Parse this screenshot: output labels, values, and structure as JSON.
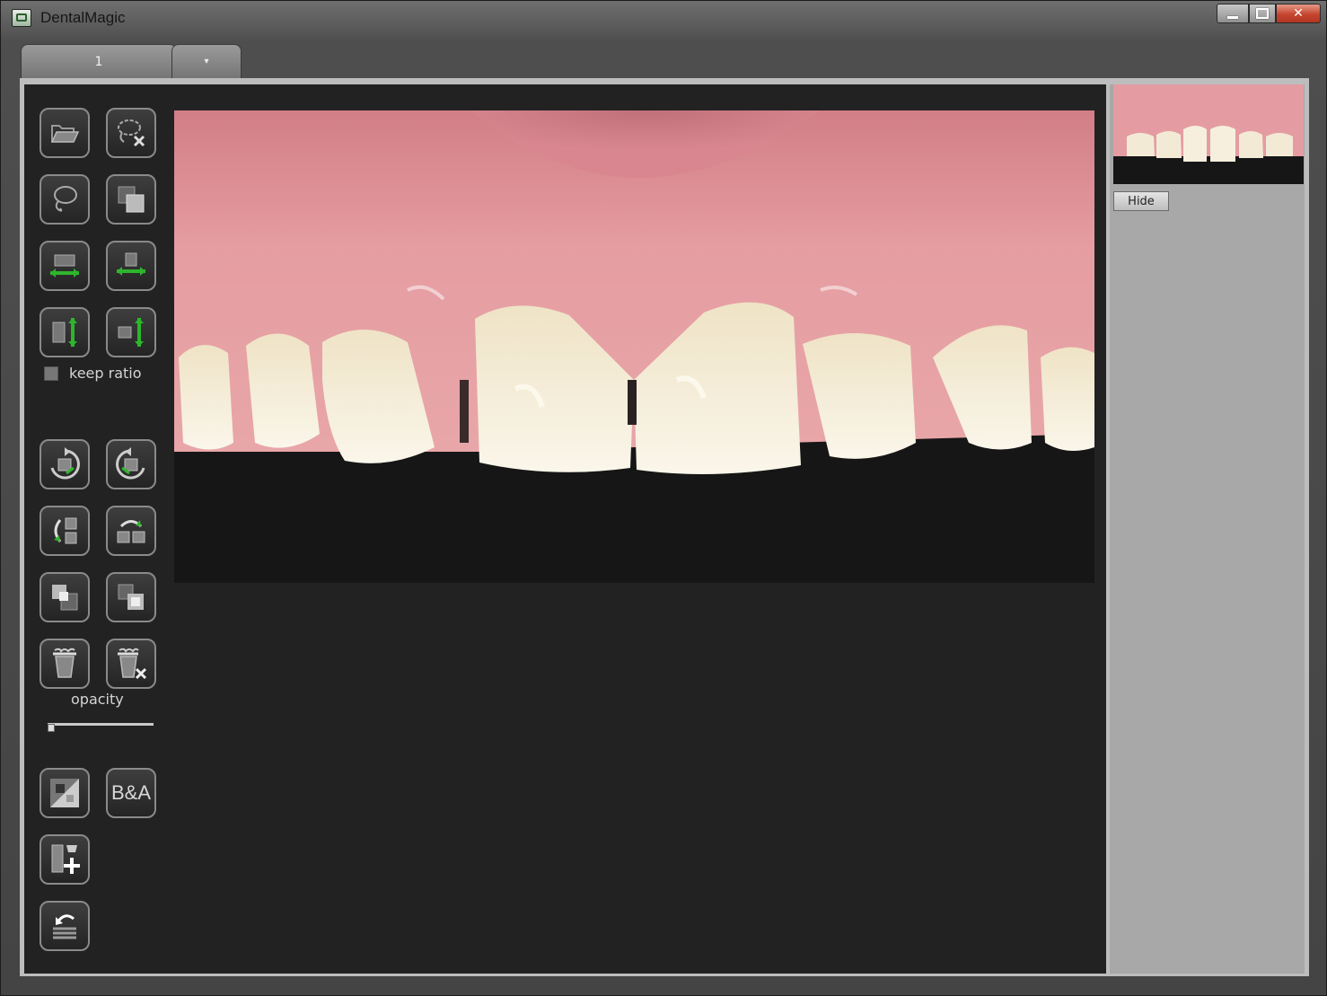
{
  "window": {
    "title": "DentalMagic",
    "controls": {
      "minimize": "minimize",
      "maximize": "maximize",
      "close": "✕"
    }
  },
  "tabs": [
    {
      "label": "1",
      "active": true
    },
    {
      "label": "▾",
      "active": false
    }
  ],
  "toolbar": {
    "buttons": [
      {
        "id": "open-image",
        "icon": "folder-open-icon"
      },
      {
        "id": "delete-selection",
        "icon": "lasso-delete-icon"
      },
      {
        "id": "lasso-select",
        "icon": "lasso-icon"
      },
      {
        "id": "duplicate-layer",
        "icon": "duplicate-icon"
      },
      {
        "id": "stretch-horizontal",
        "icon": "stretch-horizontal-icon"
      },
      {
        "id": "scale-horizontal",
        "icon": "scale-horizontal-icon"
      },
      {
        "id": "stretch-vertical",
        "icon": "stretch-vertical-icon"
      },
      {
        "id": "scale-vertical",
        "icon": "scale-vertical-icon"
      },
      {
        "id": "rotate-clockwise",
        "icon": "rotate-cw-icon"
      },
      {
        "id": "rotate-counterclockwise",
        "icon": "rotate-ccw-icon"
      },
      {
        "id": "flip-vertical",
        "icon": "flip-vertical-icon"
      },
      {
        "id": "flip-horizontal",
        "icon": "flip-horizontal-icon"
      },
      {
        "id": "bring-forward",
        "icon": "layer-forward-icon"
      },
      {
        "id": "send-backward",
        "icon": "layer-backward-icon"
      },
      {
        "id": "delete-layer",
        "icon": "trash-icon"
      },
      {
        "id": "delete-all-layers",
        "icon": "trash-x-icon"
      },
      {
        "id": "compare-split",
        "icon": "split-compare-icon"
      },
      {
        "id": "before-after",
        "icon": "before-after-icon",
        "label": "B&A"
      },
      {
        "id": "add-tooth",
        "icon": "add-tooth-icon"
      },
      {
        "id": "undo",
        "icon": "undo-icon"
      }
    ],
    "keep_ratio_label": "keep ratio",
    "keep_ratio_checked": false,
    "opacity_label": "opacity",
    "opacity_value": 0
  },
  "right_panel": {
    "hide_label": "Hide"
  },
  "colors": {
    "accent_green": "#2db52d",
    "workspace_bg": "#222222",
    "panel_bg": "#a8a8a8"
  }
}
